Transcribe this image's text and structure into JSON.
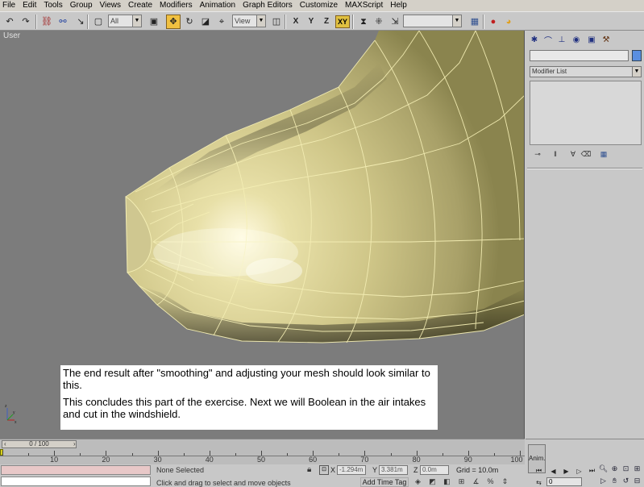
{
  "menu": {
    "items": [
      "File",
      "Edit",
      "Tools",
      "Group",
      "Views",
      "Create",
      "Modifiers",
      "Animation",
      "Graph Editors",
      "Customize",
      "MAXScript",
      "Help"
    ]
  },
  "toolbar": {
    "selection_filter": "All",
    "reference_coord": "View",
    "axis_constraint_label": "XY",
    "named_selection": ""
  },
  "viewport": {
    "label": "User",
    "caption_line1": "The end result after \"smoothing\" and adjusting your mesh should look similar to this.",
    "caption_line2": "This concludes this part of the exercise.  Next we will Boolean in the air intakes and cut in the windshield.",
    "mesh_color": "#d8d090",
    "wire_color": "#f4eeb4",
    "background_color": "#7c7c7c"
  },
  "command_panel": {
    "object_name": "",
    "object_color": "#5a8fe0",
    "modifier_list": "Modifier List"
  },
  "timeline": {
    "frame_display": "0 / 100",
    "ticks": [
      "10",
      "20",
      "30",
      "40",
      "50",
      "60",
      "70",
      "80",
      "90",
      "100"
    ]
  },
  "status": {
    "selection": "None Selected",
    "prompt": "Click and drag to select and move objects",
    "x_label": "X",
    "x_value": "-1.294m",
    "y_label": "Y",
    "y_value": "3.381m",
    "z_label": "Z",
    "z_value": "0.0m",
    "grid": "Grid = 10.0m",
    "add_time_tag": "Add Time Tag"
  },
  "anim": {
    "anim_label": "Anim.",
    "current_frame": "0"
  }
}
